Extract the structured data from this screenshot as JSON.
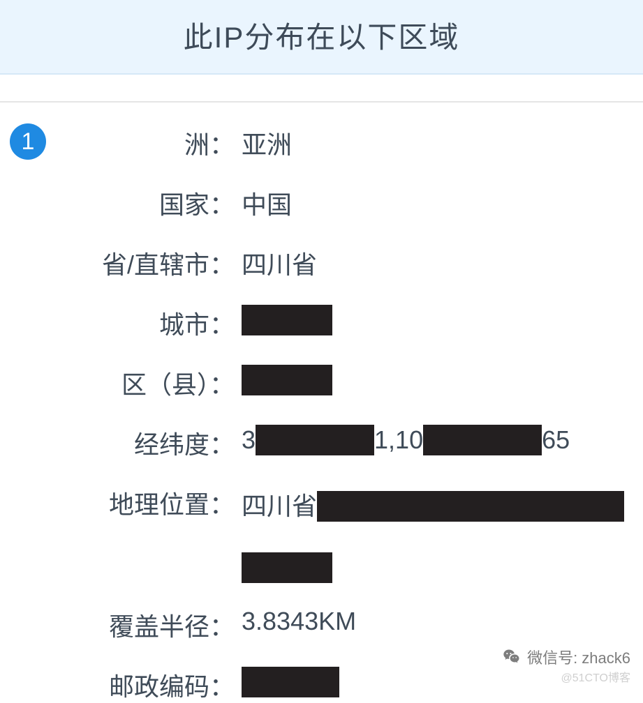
{
  "header": {
    "title": "此IP分布在以下区域"
  },
  "badge": "1",
  "rows": {
    "continent": {
      "label": "洲：",
      "value": "亚洲"
    },
    "country": {
      "label": "国家：",
      "value": "中国"
    },
    "province": {
      "label": "省/直辖市：",
      "value": "四川省"
    },
    "city": {
      "label": "城市：",
      "value": ""
    },
    "district": {
      "label": "区（县）：",
      "value": ""
    },
    "latlon": {
      "label": "经纬度：",
      "prefix": "3",
      "mid": "1,10",
      "suffix": "65"
    },
    "geoloc": {
      "label": "地理位置：",
      "value": "四川省"
    },
    "radius": {
      "label": "覆盖半径：",
      "value": "3.8343KM"
    },
    "postal": {
      "label": "邮政编码：",
      "value": ""
    }
  },
  "watermark": {
    "wechat_label": "微信号: zhack6",
    "sub": "@51CTO博客"
  }
}
